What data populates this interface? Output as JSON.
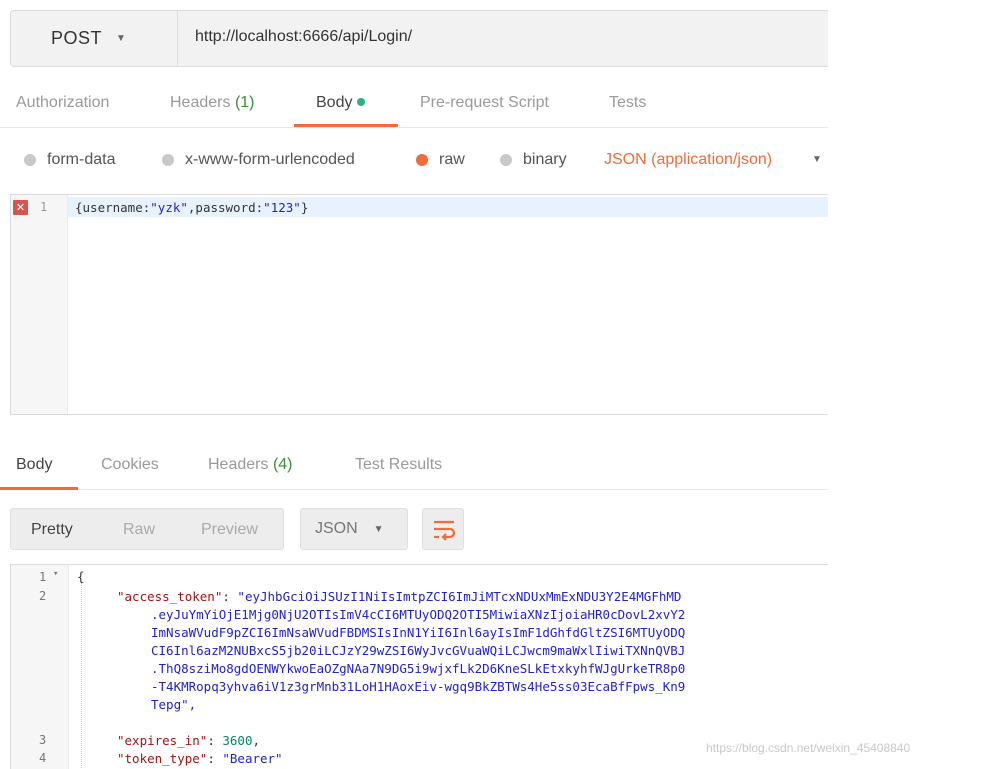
{
  "request": {
    "method": "POST",
    "url": "http://localhost:6666/api/Login/"
  },
  "request_tabs": {
    "authorization": "Authorization",
    "headers": "Headers",
    "headers_count": "(1)",
    "body": "Body",
    "prerequest": "Pre-request Script",
    "tests": "Tests"
  },
  "body_types": {
    "form_data": "form-data",
    "urlencoded": "x-www-form-urlencoded",
    "raw": "raw",
    "binary": "binary",
    "selected": "raw",
    "content_type": "JSON (application/json)"
  },
  "request_body": {
    "line_number": "1",
    "prefix": "{username:",
    "username_value": "\"yzk\"",
    "middle": ",password:",
    "password_value": "\"123\"",
    "suffix": "}"
  },
  "response_tabs": {
    "body": "Body",
    "cookies": "Cookies",
    "headers": "Headers",
    "headers_count": "(4)",
    "test_results": "Test Results"
  },
  "response_format": {
    "pretty": "Pretty",
    "raw": "Raw",
    "preview": "Preview",
    "language": "JSON"
  },
  "response_body": {
    "line_numbers": [
      "1",
      "2",
      "3",
      "4"
    ],
    "open_brace": "{",
    "access_token_key": "\"access_token\"",
    "access_token_lines": [
      "\"eyJhbGciOiJSUzI1NiIsImtpZCI6ImJiMTcxNDUxMmExNDU3Y2E4MGFhMD",
      ".eyJuYmYiOjE1Mjg0NjU2OTIsImV4cCI6MTUyODQ2OTI5MiwiaXNzIjoiaHR0cDovL2xvY2",
      "ImNsaWVudF9pZCI6ImNsaWVudFBDMSIsInN1YiI6Inl6ayIsImF1dGhfdGltZSI6MTUyODQ",
      "CI6Inl6azM2NUBxcS5jb20iLCJzY29wZSI6WyJvcGVuaWQiLCJwcm9maWxlIiwiTXNnQVBJ",
      ".ThQ8sziMo8gdOENWYkwoEaOZgNAa7N9DG5i9wjxfLk2D6KneSLkEtxkyhfWJgUrkeTR8p0",
      "-T4KMRopq3yhva6iV1z3grMnb31LoH1HAoxEiv-wgq9BkZBTWs4He5ss03EcaBfFpws_Kn9",
      "Tepg\","
    ],
    "expires_in_key": "\"expires_in\"",
    "expires_in_value": "3600",
    "token_type_key": "\"token_type\"",
    "token_type_value": "\"Bearer\""
  },
  "watermark": "https://blog.csdn.net/weixin_45408840",
  "colors": {
    "accent": "#f26b3a",
    "green_dot": "#26b47f",
    "count_green": "#3a8f3a",
    "string_blue": "#2323c8",
    "key_red": "#a31515"
  }
}
